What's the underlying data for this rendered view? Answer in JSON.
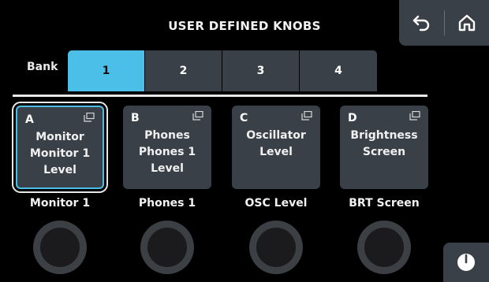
{
  "header": {
    "title": "USER DEFINED KNOBS"
  },
  "top_buttons": {
    "back_icon": "undo-arrow-icon",
    "home_icon": "home-icon"
  },
  "bank": {
    "label": "Bank",
    "tabs": [
      {
        "label": "1",
        "active": true
      },
      {
        "label": "2",
        "active": false
      },
      {
        "label": "3",
        "active": false
      },
      {
        "label": "4",
        "active": false
      }
    ]
  },
  "knobs": [
    {
      "letter": "A",
      "lines": [
        "Monitor",
        "Monitor 1",
        "Level"
      ],
      "name": "Monitor 1",
      "selected": true
    },
    {
      "letter": "B",
      "lines": [
        "Phones",
        "Phones 1",
        "Level"
      ],
      "name": "Phones 1",
      "selected": false
    },
    {
      "letter": "C",
      "lines": [
        "Oscillator",
        "Level"
      ],
      "name": "OSC Level",
      "selected": false
    },
    {
      "letter": "D",
      "lines": [
        "Brightness",
        "Screen"
      ],
      "name": "BRT Screen",
      "selected": false
    }
  ],
  "corner_button": {
    "icon": "meter-dial-icon"
  },
  "colors": {
    "accent": "#4bbfe8",
    "panel": "#3a4047",
    "background": "#000000"
  }
}
